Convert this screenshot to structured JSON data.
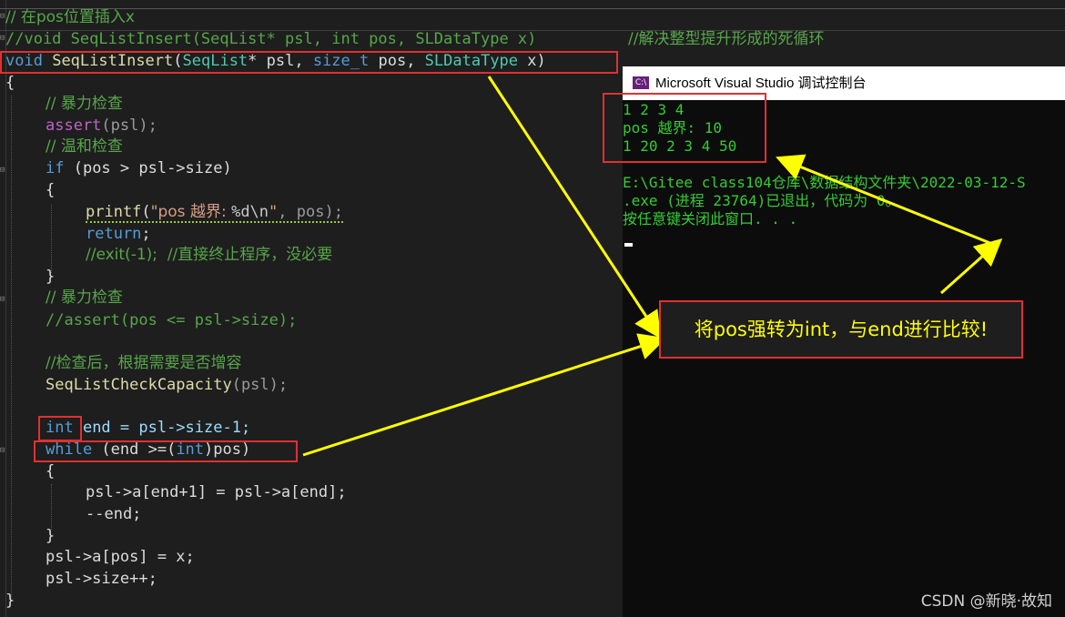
{
  "code": {
    "line1": "// 在pos位置插入x",
    "line2a": "//void SeqListInsert(SeqList* psl, int pos, SLDataType x)",
    "line2b": "//解决整型提升形成的死循环",
    "line3": [
      "void",
      "SeqListInsert",
      "(",
      "SeqList",
      "* psl, ",
      "size_t",
      " pos, ",
      "SLDataType",
      " x)"
    ],
    "brace_open": "{",
    "c_violent": "// 暴力检查",
    "assert_fn": "assert",
    "assert_args": "(psl);",
    "c_gentle": "// 温和检查",
    "if_kw": "if",
    "if_cond": " (pos > psl->size)",
    "inner_open": "{",
    "printf_fn": "printf",
    "printf_pre": "(",
    "printf_str1": "\"pos 越界: ",
    "printf_fmt": "%d\\n",
    "printf_str2": "\"",
    "printf_post": ", pos);",
    "return_kw": "return",
    "return_post": ";",
    "exit_comment": "//exit(-1);  //直接终止程序，没必要",
    "inner_close": "}",
    "c_violent2": "// 暴力检查",
    "c_assert2": "//assert(pos <= psl->size);",
    "c_after": "//检查后，根据需要是否增容",
    "capacity_fn": "SeqListCheckCapacity",
    "capacity_args": "(psl);",
    "int_kw": "int",
    "end_decl": " end = psl->size-1;",
    "while_kw": "while",
    "while_cond1": " (end >=(",
    "while_int": "int",
    "while_cond2": ")pos)",
    "loop_open": "{",
    "loop_body1": "psl->a[end+1] = psl->a[end];",
    "loop_body2": "--end;",
    "loop_close": "}",
    "assign": "psl->a[pos] = x;",
    "size_inc": "psl->size++;",
    "brace_close": "}"
  },
  "console": {
    "title": "Microsoft Visual Studio 调试控制台",
    "icon_label": "C:\\",
    "lines": [
      "1 2 3 4",
      "pos 越界: 10",
      "1 20 2 3 4 50",
      "",
      "E:\\Gitee class104仓库\\数据结构文件夹\\2022-03-12-S",
      ".exe (进程 23764)已退出，代码为 0。",
      "按任意键关闭此窗口. . ."
    ]
  },
  "annotation": {
    "callout": "将pos强转为int，与end进行比较!",
    "arrow_color": "#ffff00",
    "box_color": "#e03030"
  },
  "watermark": "CSDN @新晓·故知"
}
